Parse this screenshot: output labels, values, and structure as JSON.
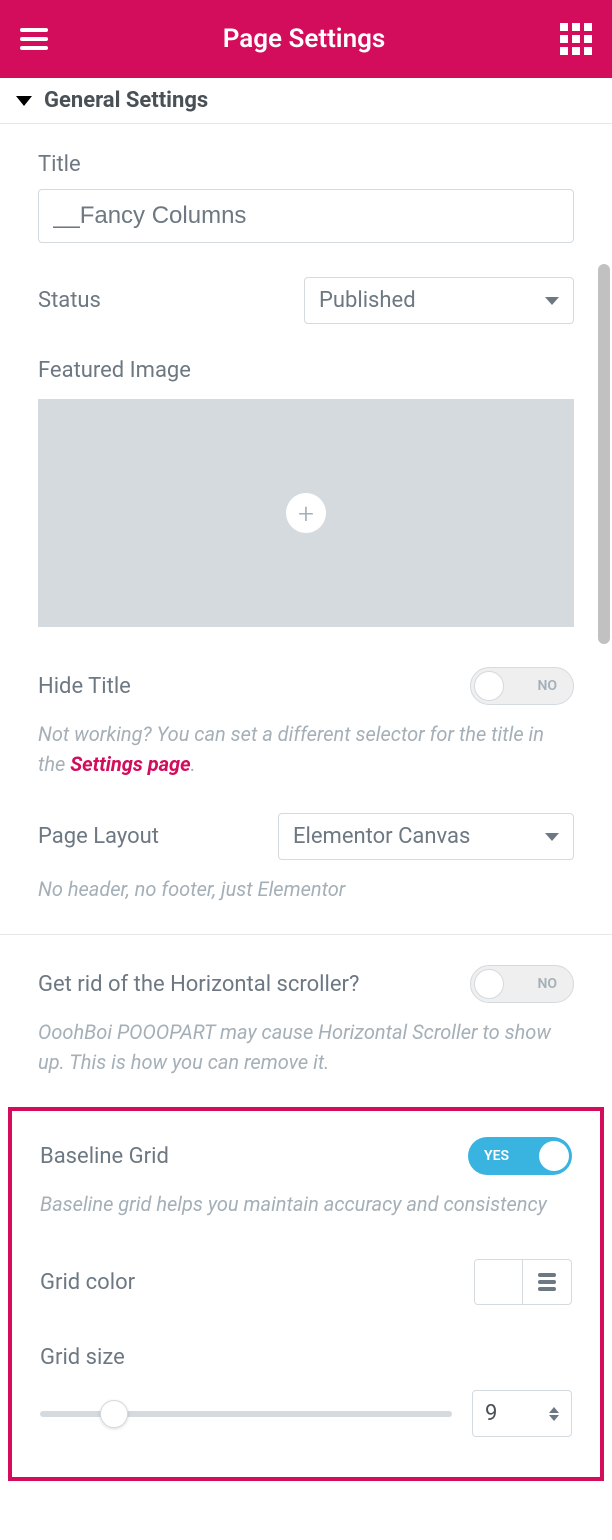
{
  "header": {
    "title": "Page Settings"
  },
  "section": {
    "title": "General Settings"
  },
  "general": {
    "title_label": "Title",
    "title_value": "__Fancy Columns",
    "status_label": "Status",
    "status_value": "Published",
    "featured_image_label": "Featured Image",
    "hide_title_label": "Hide Title",
    "hide_title_toggle": "NO",
    "hide_title_help_prefix": "Not working? You can set a different selector for the title in the ",
    "hide_title_help_link": "Settings page",
    "hide_title_help_suffix": ".",
    "page_layout_label": "Page Layout",
    "page_layout_value": "Elementor Canvas",
    "page_layout_help": "No header, no footer, just Elementor"
  },
  "scroller": {
    "label": "Get rid of the Horizontal scroller?",
    "toggle": "NO",
    "help": "OoohBoi POOOPART may cause Horizontal Scroller to show up. This is how you can remove it."
  },
  "baseline": {
    "label": "Baseline Grid",
    "toggle": "YES",
    "help": "Baseline grid helps you maintain accuracy and consistency",
    "grid_color_label": "Grid color",
    "grid_size_label": "Grid size",
    "grid_size_value": "9"
  }
}
